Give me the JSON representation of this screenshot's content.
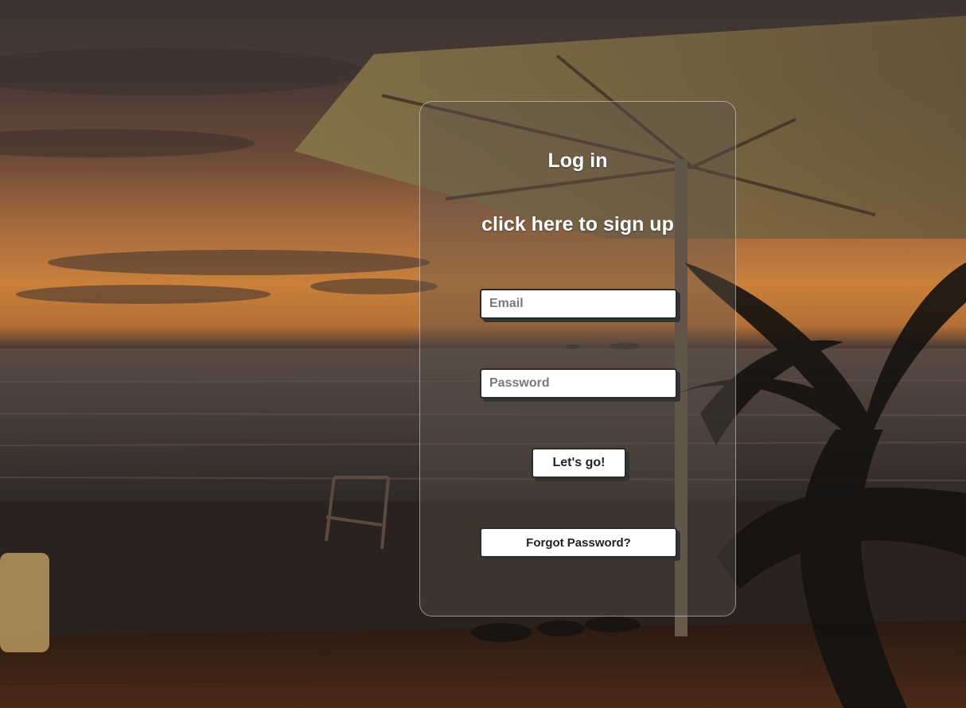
{
  "login": {
    "title": "Log in",
    "signup_link": "click here to sign up",
    "email_placeholder": "Email",
    "email_value": "",
    "password_placeholder": "Password",
    "password_value": "",
    "submit_label": "Let's go!",
    "forgot_label": "Forgot Password?"
  },
  "colors": {
    "card_border": "#ffffff",
    "text": "#ffffff",
    "button_bg": "#ffffff",
    "button_shadow": "#333333"
  }
}
